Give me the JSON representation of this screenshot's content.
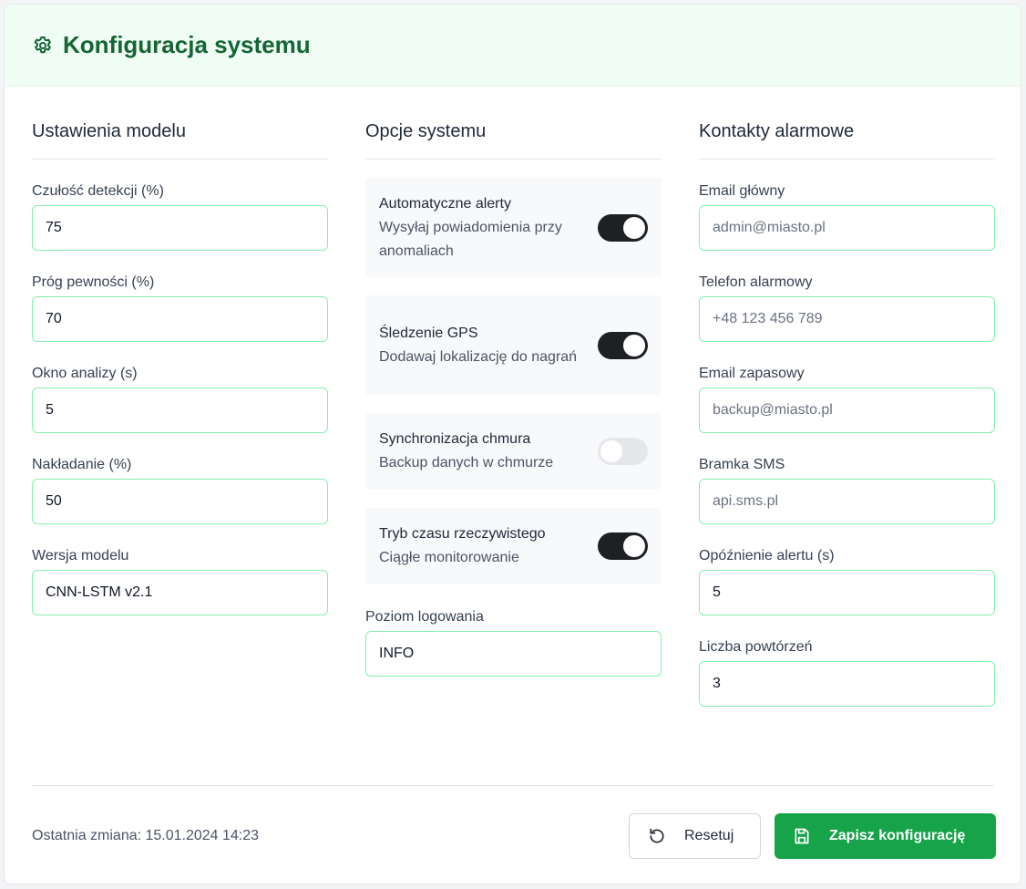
{
  "header": {
    "title": "Konfiguracja systemu",
    "icon": "gear-icon"
  },
  "model": {
    "title": "Ustawienia modelu",
    "fields": [
      {
        "label": "Czułość detekcji (%)",
        "value": "75"
      },
      {
        "label": "Próg pewności (%)",
        "value": "70"
      },
      {
        "label": "Okno analizy (s)",
        "value": "5"
      },
      {
        "label": "Nakładanie (%)",
        "value": "50"
      },
      {
        "label": "Wersja modelu",
        "value": "CNN-LSTM v2.1"
      }
    ]
  },
  "system": {
    "title": "Opcje systemu",
    "toggles": [
      {
        "title": "Automatyczne alerty",
        "desc": "Wysyłaj powiadomienia przy anomaliach",
        "on": true
      },
      {
        "title": "Śledzenie GPS",
        "desc": "Dodawaj lokalizację do nagrań",
        "on": true
      },
      {
        "title": "Synchronizacja chmura",
        "desc": "Backup danych w chmurze",
        "on": false
      },
      {
        "title": "Tryb czasu rzeczywistego",
        "desc": "Ciągłe monitorowanie",
        "on": true
      }
    ],
    "log_label": "Poziom logowania",
    "log_value": "INFO"
  },
  "contacts": {
    "title": "Kontakty alarmowe",
    "fields": [
      {
        "label": "Email główny",
        "placeholder": "admin@miasto.pl"
      },
      {
        "label": "Telefon alarmowy",
        "placeholder": "+48 123 456 789"
      },
      {
        "label": "Email zapasowy",
        "placeholder": "backup@miasto.pl"
      },
      {
        "label": "Bramka SMS",
        "placeholder": "api.sms.pl"
      },
      {
        "label": "Opóźnienie alertu (s)",
        "value": "5"
      },
      {
        "label": "Liczba powtórzeń",
        "value": "3"
      }
    ]
  },
  "footer": {
    "last_change": "Ostatnia zmiana: 15.01.2024 14:23",
    "reset": "Resetuj",
    "save": "Zapisz konfigurację"
  },
  "colors": {
    "accent": "#16a34a",
    "header_bg": "#effdf4",
    "title": "#166534"
  }
}
